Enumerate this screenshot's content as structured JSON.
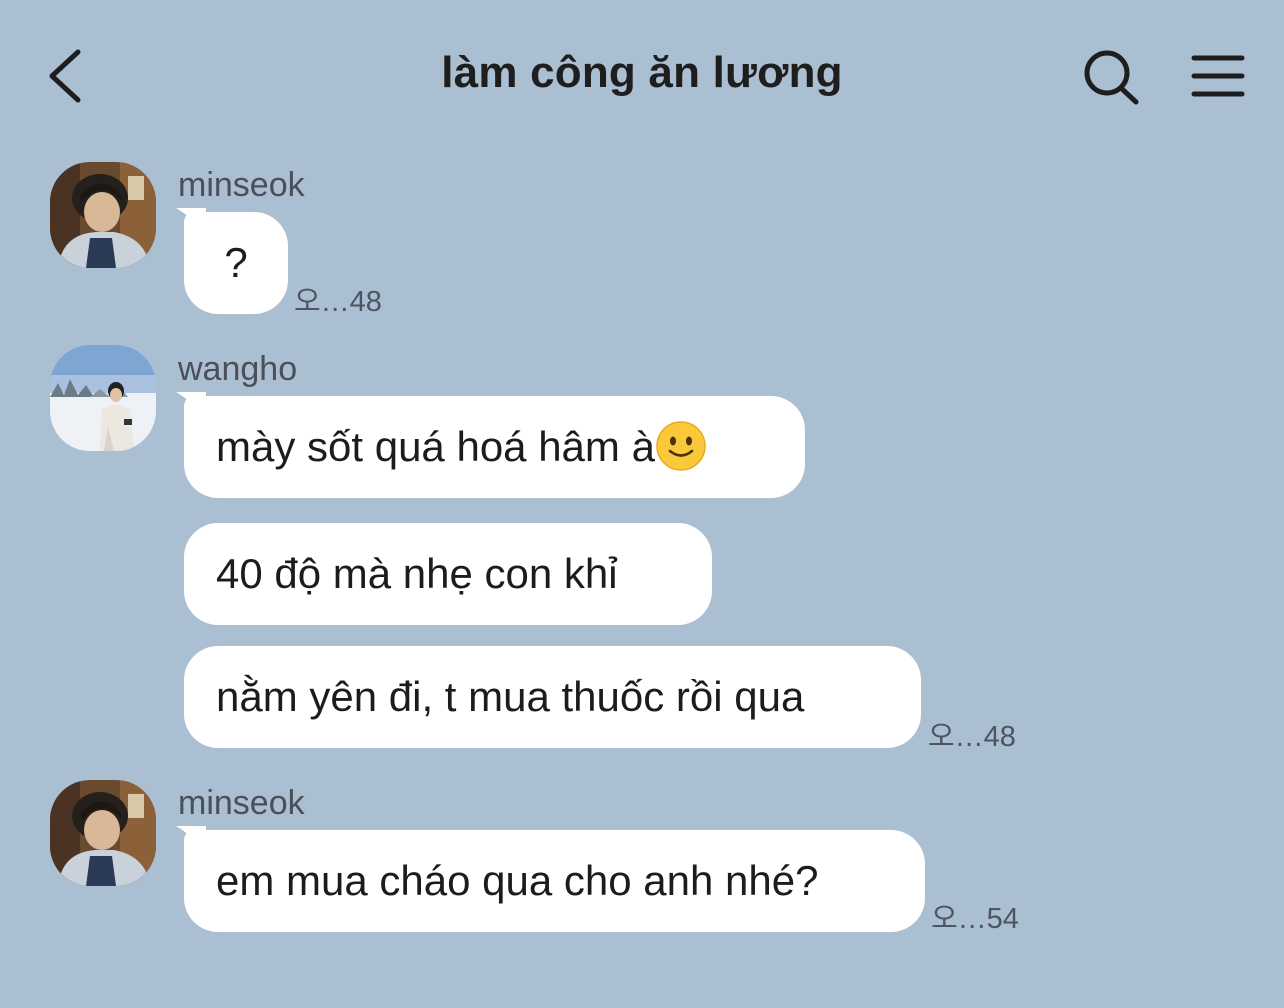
{
  "header": {
    "title": "làm công ăn lương",
    "back_icon": "chevron-left-icon",
    "search_icon": "search-icon",
    "menu_icon": "hamburger-menu-icon"
  },
  "messages": [
    {
      "sender": "minseok",
      "avatar": "avatar-minseok",
      "bubbles": [
        "?"
      ],
      "time": "오…48"
    },
    {
      "sender": "wangho",
      "avatar": "avatar-wangho",
      "bubbles": [
        "mày sốt quá hoá hâm à",
        "40 độ mà nhẹ con khỉ",
        "nằm yên đi, t mua thuốc rồi qua"
      ],
      "emoji": "slightly-smiling-face-icon",
      "time": "오…48"
    },
    {
      "sender": "minseok",
      "avatar": "avatar-minseok",
      "bubbles": [
        "em mua cháo qua cho anh nhé?"
      ],
      "time": "오…54"
    }
  ],
  "colors": {
    "background": "#abbfd2",
    "bubble": "#ffffff",
    "text": "#1c1c1c",
    "meta_text": "#4e5560"
  }
}
